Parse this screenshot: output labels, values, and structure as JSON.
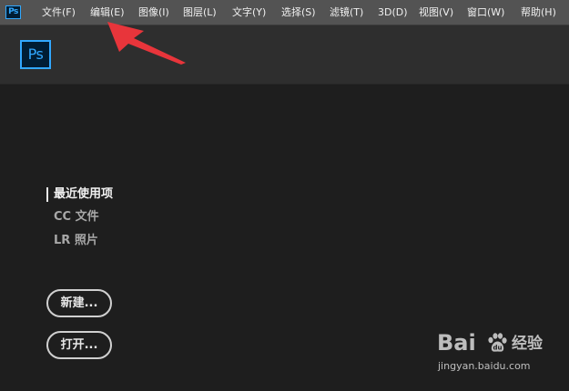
{
  "app": {
    "small_logo": "Ps",
    "logo": "Ps"
  },
  "menu": {
    "items": [
      {
        "label": "文件(F)"
      },
      {
        "label": "编辑(E)"
      },
      {
        "label": "图像(I)"
      },
      {
        "label": "图层(L)"
      },
      {
        "label": "文字(Y)"
      },
      {
        "label": "选择(S)"
      },
      {
        "label": "滤镜(T)"
      },
      {
        "label": "3D(D)"
      },
      {
        "label": "视图(V)"
      },
      {
        "label": "窗口(W)"
      },
      {
        "label": "帮助(H)"
      }
    ]
  },
  "nav": {
    "items": [
      {
        "label": "最近使用项",
        "active": true
      },
      {
        "label": "CC 文件",
        "active": false
      },
      {
        "label": "LR 照片",
        "active": false
      }
    ]
  },
  "buttons": {
    "new_label": "新建...",
    "open_label": "打开..."
  },
  "annotation": {
    "color": "#e8353b",
    "icon": "arrow-pointing-to-edit-menu"
  },
  "watermark": {
    "logo_text_1": "Bai",
    "logo_text_2": "经验",
    "url": "jingyan.baidu.com"
  },
  "colors": {
    "menubar_bg": "#535353",
    "header_bg": "#2e2e2e",
    "main_bg": "#1e1e1e",
    "ps_blue": "#31a8ff",
    "ps_dark": "#001d34"
  }
}
